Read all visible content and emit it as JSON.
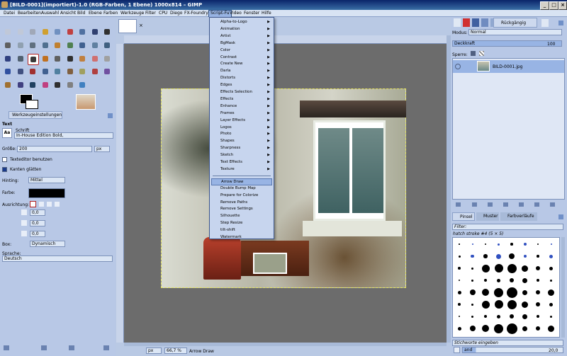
{
  "window": {
    "title": "[BILD-0001](importiert)-1.0 (RGB-Farben, 1 Ebene) 1000x814 – GIMP"
  },
  "menubar": [
    "Datei",
    "Bearbeiten",
    "Auswahl",
    "Ansicht",
    "Bild",
    "Ebene",
    "Farben",
    "Werkzeuge",
    "Filter",
    "CPU",
    "Diego",
    "FX-Foundry",
    "Script-Fu",
    "Video",
    "Fenster",
    "Hilfe"
  ],
  "script_fu_menu": {
    "submenus": [
      "Alpha-to-Logo",
      "Animation",
      "Artist",
      "BgMask",
      "Color",
      "Contrast",
      "Create New",
      "Darla",
      "Distorts",
      "Edges",
      "Effects Selection",
      "Effects",
      "Enhance",
      "Frames",
      "Layer Effects",
      "Logos",
      "Photo",
      "Shapes",
      "Sharpness",
      "Sketch",
      "Text Effects",
      "Texture"
    ],
    "scripts": [
      "Arrow Draw",
      "Double Bump Map",
      "Prepare for Colorize",
      "Remove Paths",
      "Remove Settings",
      "Silhouette",
      "Step Resize",
      "tilt-shift",
      "Watermark"
    ],
    "highlighted": "Arrow Draw"
  },
  "tool_options": {
    "tab": "Werkzeugeinstellungen",
    "title": "Text",
    "font_label": "Schrift",
    "font_value": "In-House Edition Bold,",
    "size_label": "Größe:",
    "size_value": "200",
    "size_unit": "px",
    "use_editor": "Texteditor benutzen",
    "antialias": "Kanten glätten",
    "hinting_label": "Hinting:",
    "hinting_value": "Mittel",
    "color_label": "Farbe:",
    "justify_label": "Ausrichtung:",
    "indent_value": "0,0",
    "line_spacing_value": "0,0",
    "letter_spacing_value": "0,0",
    "box_label": "Box:",
    "box_value": "Dynamisch",
    "language_label": "Sprache:",
    "language_value": "Deutsch"
  },
  "status": {
    "unit": "px",
    "zoom": "66,7 %",
    "message": "Arrow Draw"
  },
  "layers": {
    "mode_label": "Modus:",
    "mode_value": "Normal",
    "opacity_label": "Deckkraft",
    "opacity_value": "100",
    "lock_label": "Sperre:",
    "undo_label": "Rückgängig",
    "layer_name": "BILD-0001.jpg"
  },
  "brushes": {
    "tabs": [
      "Pinsel",
      "Muster",
      "Farbverläufe"
    ],
    "filter_label": "Filter:",
    "brush_name": "hatch stroke #4 (5 × 5)",
    "tag_placeholder": "Stichworte eingeben",
    "preset_name": "and",
    "spacing_value": "20,0"
  },
  "colors": {
    "accent": "#98b4e4",
    "fg": "#000000",
    "bg": "#ffffff"
  }
}
